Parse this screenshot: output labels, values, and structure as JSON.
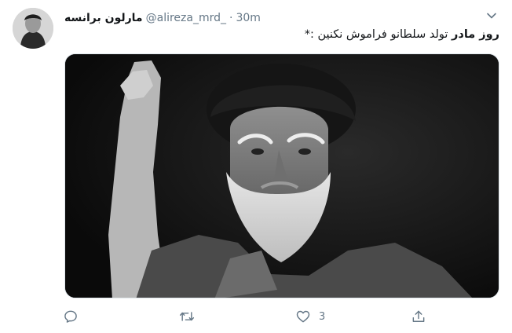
{
  "tweet": {
    "author_name": "مارلون برانسه",
    "handle": "@alireza_mrd_",
    "separator": "·",
    "time": "30m",
    "text_bold": "روز مادر",
    "text_rest": " تولد سلطانو فراموش نکنین :*"
  },
  "actions": {
    "reply_count": "",
    "retweet_count": "",
    "like_count": "3",
    "share_count": ""
  },
  "colors": {
    "text": "#14171a",
    "muted": "#657786",
    "border": "#e1e8ed"
  },
  "icons": [
    "chevron-down-icon",
    "reply-icon",
    "retweet-icon",
    "heart-icon",
    "share-icon"
  ]
}
